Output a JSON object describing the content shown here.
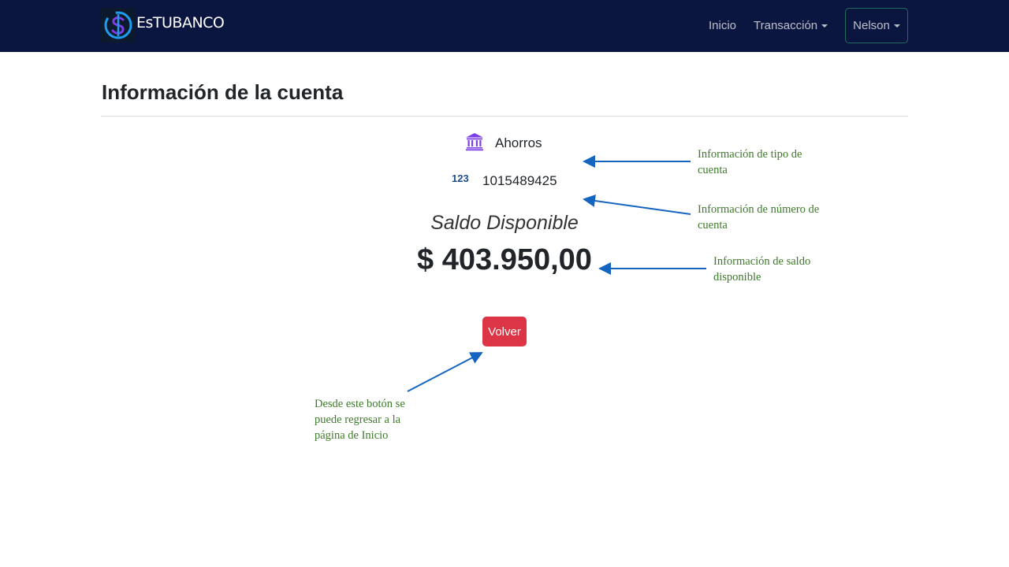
{
  "navbar": {
    "brand_name": "EsTUBANCO",
    "links": [
      {
        "label": "Inicio"
      },
      {
        "label": "Transacción"
      }
    ],
    "user_label": "Nelson",
    "colors": {
      "background": "#0b1640",
      "logo_blue": "#1e9df0",
      "logo_purple": "#7b3fe4"
    }
  },
  "page": {
    "title": "Información de la cuenta"
  },
  "account": {
    "type_icon": "bank-icon",
    "type": "Ahorros",
    "number_icon": "123",
    "number": "1015489425",
    "balance_label": "Saldo Disponible",
    "balance": "$ 403.950,00"
  },
  "actions": {
    "back_label": "Volver",
    "back_color": "#dc3545"
  },
  "annotations": [
    {
      "text": "Información  de tipo  de cuenta"
    },
    {
      "text": "Información  de número de cuenta"
    },
    {
      "text": "Información  de saldo disponible"
    },
    {
      "text": "Desde este botón se puede regresar  a la página  de Inicio"
    }
  ]
}
